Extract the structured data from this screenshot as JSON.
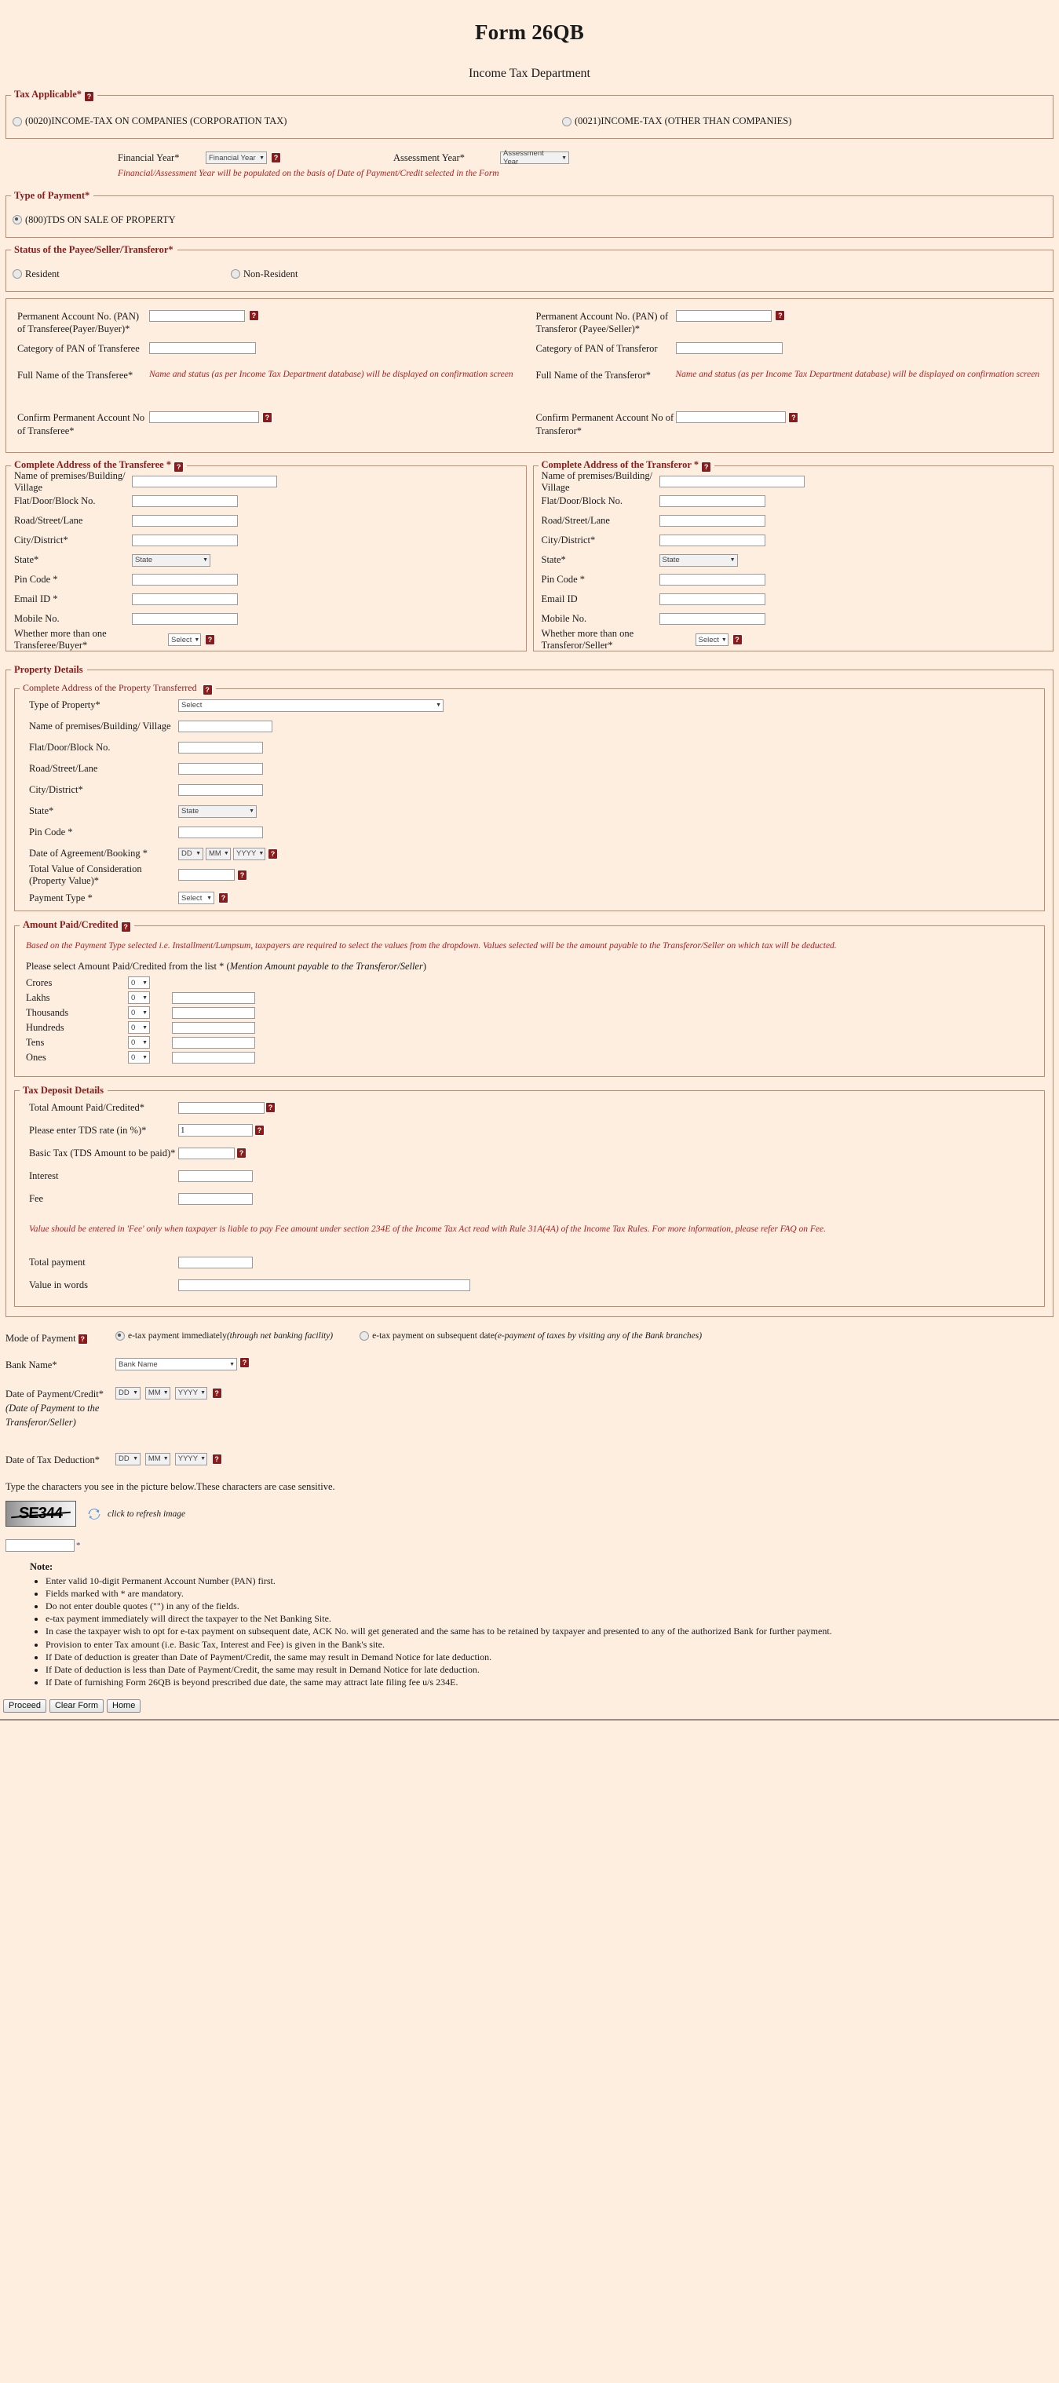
{
  "header": {
    "form_title": "Form 26QB",
    "dept_title": "Income Tax Department"
  },
  "tax_applicable": {
    "legend": "Tax Applicable*",
    "help_icon": "question-icon",
    "options": [
      {
        "label": "(0020)INCOME-TAX ON COMPANIES (CORPORATION TAX)",
        "selected": false
      },
      {
        "label": "(0021)INCOME-TAX (OTHER THAN COMPANIES)",
        "selected": false
      }
    ],
    "financial_year_label": "Financial Year*",
    "financial_year_value": "Financial Year",
    "assessment_year_label": "Assessment Year*",
    "assessment_year_value": "Assessment Year",
    "year_note": "Financial/Assessment Year will be populated on the basis of Date of Payment/Credit selected in the Form"
  },
  "type_of_payment": {
    "legend": "Type of Payment*",
    "options": [
      {
        "label": "(800)TDS ON SALE OF PROPERTY",
        "selected": true
      }
    ]
  },
  "status_of_payee": {
    "legend": "Status of the Payee/Seller/Transferor*",
    "options": [
      {
        "label": "Resident",
        "selected": false
      },
      {
        "label": "Non-Resident",
        "selected": false
      }
    ]
  },
  "pan_section": {
    "transferee": {
      "pan_label": "Permanent Account No. (PAN) of Transferee(Payer/Buyer)*",
      "pan_value": "",
      "category_label": "Category of PAN of Transferee",
      "category_value": "",
      "full_name_label": "Full Name of the Transferee*",
      "full_name_hint": "Name and status (as per Income Tax Department database) will be displayed on confirmation screen",
      "confirm_label": "Confirm Permanent Account No of Transferee*",
      "confirm_value": ""
    },
    "transferor": {
      "pan_label": "Permanent Account No. (PAN) of Transferor (Payee/Seller)*",
      "pan_value": "",
      "category_label": "Category of PAN of Transferor",
      "category_value": "",
      "full_name_label": "Full Name of the Transferor*",
      "full_name_hint": "Name and status (as per Income Tax Department database) will be displayed on confirmation screen",
      "confirm_label": "Confirm Permanent Account No of Transferor*",
      "confirm_value": ""
    }
  },
  "address_transferee": {
    "legend": "Complete Address of the Transferee *",
    "fields": [
      {
        "label": "Name of premises/Building/ Village",
        "type": "text",
        "value": "",
        "width": "xl"
      },
      {
        "label": "Flat/Door/Block No.",
        "type": "text",
        "value": "",
        "width": "lg"
      },
      {
        "label": "Road/Street/Lane",
        "type": "text",
        "value": "",
        "width": "lg"
      },
      {
        "label": "City/District*",
        "type": "text",
        "value": "",
        "width": "lg"
      },
      {
        "label": "State*",
        "type": "select",
        "value": "State",
        "width": "state"
      },
      {
        "label": "Pin Code *",
        "type": "text",
        "value": "",
        "width": "lg"
      },
      {
        "label": "Email ID *",
        "type": "text",
        "value": "",
        "width": "lg"
      },
      {
        "label": "Mobile No.",
        "type": "text",
        "value": "",
        "width": "lg"
      }
    ],
    "multi_label": "Whether more than one Transferee/Buyer*",
    "multi_value": "Select"
  },
  "address_transferor": {
    "legend": "Complete Address of the Transferor *",
    "fields": [
      {
        "label": "Name of premises/Building/ Village",
        "type": "text",
        "value": "",
        "width": "xl"
      },
      {
        "label": "Flat/Door/Block No.",
        "type": "text",
        "value": "",
        "width": "lg"
      },
      {
        "label": "Road/Street/Lane",
        "type": "text",
        "value": "",
        "width": "lg"
      },
      {
        "label": "City/District*",
        "type": "text",
        "value": "",
        "width": "lg"
      },
      {
        "label": "State*",
        "type": "select",
        "value": "State",
        "width": "state"
      },
      {
        "label": "Pin Code *",
        "type": "text",
        "value": "",
        "width": "lg"
      },
      {
        "label": "Email ID",
        "type": "text",
        "value": "",
        "width": "lg"
      },
      {
        "label": "Mobile No.",
        "type": "text",
        "value": "",
        "width": "lg"
      }
    ],
    "multi_label": "Whether more than one Transferor/Seller*",
    "multi_value": "Select"
  },
  "property_details": {
    "legend": "Property Details",
    "address_legend": "Complete Address of the Property Transferred",
    "type_of_property_label": "Type of Property*",
    "type_of_property_value": "Select",
    "fields": [
      {
        "label": "Name of premises/Building/ Village",
        "type": "text",
        "value": "",
        "width": "xl"
      },
      {
        "label": "Flat/Door/Block No.",
        "type": "text",
        "value": "",
        "width": "lg"
      },
      {
        "label": "Road/Street/Lane",
        "type": "text",
        "value": "",
        "width": "lg"
      },
      {
        "label": "City/District*",
        "type": "text",
        "value": "",
        "width": "lg"
      },
      {
        "label": "State*",
        "type": "select",
        "value": "State",
        "width": "state"
      },
      {
        "label": "Pin Code *",
        "type": "text",
        "value": "",
        "width": "lg"
      }
    ],
    "date_agreement_label": "Date of Agreement/Booking *",
    "date_agreement": {
      "dd": "DD",
      "mm": "MM",
      "yyyy": "YYYY"
    },
    "total_value_label": "Total Value of Consideration (Property Value)*",
    "total_value": "",
    "payment_type_label": "Payment Type *",
    "payment_type_value": "Select"
  },
  "amount_paid": {
    "legend": "Amount Paid/Credited",
    "note": "Based on the Payment Type selected i.e. Installment/Lumpsum, taxpayers are required to select the values from the dropdown. Values selected will be the amount payable to the Transferor/Seller on which tax will be deducted.",
    "instruction_plain": "Please select Amount Paid/Credited from the list * (",
    "instruction_italic": "Mention Amount payable to the Transferor/Seller",
    "instruction_tail": ")",
    "rows": [
      {
        "label": "Crores",
        "select": "0",
        "text": "",
        "has_text": false
      },
      {
        "label": "Lakhs",
        "select": "0",
        "text": "",
        "has_text": true
      },
      {
        "label": "Thousands",
        "select": "0",
        "text": "",
        "has_text": true
      },
      {
        "label": "Hundreds",
        "select": "0",
        "text": "",
        "has_text": true
      },
      {
        "label": "Tens",
        "select": "0",
        "text": "",
        "has_text": true
      },
      {
        "label": "Ones",
        "select": "0",
        "text": "",
        "has_text": true
      }
    ]
  },
  "tax_deposit": {
    "legend": "Tax Deposit Details",
    "rows": [
      {
        "label": "Total Amount Paid/Credited*",
        "value": "",
        "width": "xl",
        "help": true
      },
      {
        "label": "Please enter TDS rate (in %)*",
        "value": "1",
        "width": "lg",
        "help": true
      },
      {
        "label": "Basic Tax (TDS Amount to be paid)*",
        "value": "",
        "width": "sm",
        "help": true
      },
      {
        "label": "Interest",
        "value": "",
        "width": "lg",
        "help": false
      },
      {
        "label": "Fee",
        "value": "",
        "width": "lg",
        "help": false
      }
    ],
    "fee_note": "Value should be entered in 'Fee' only when taxpayer is liable to pay Fee amount under section 234E of the Income Tax Act read with Rule 31A(4A) of the Income Tax Rules. For more information, please refer FAQ on Fee.",
    "total_payment_label": "Total payment",
    "total_payment_value": "",
    "value_words_label": "Value in words",
    "value_words_value": ""
  },
  "mode_of_payment": {
    "label": "Mode of Payment",
    "options": [
      {
        "plain": "e-tax payment immediately ",
        "italic": "(through net banking facility)",
        "selected": true
      },
      {
        "plain": "e-tax payment on subsequent date ",
        "italic": "(e-payment of taxes by visiting any of the Bank branches)",
        "selected": false
      }
    ],
    "bank_name_label": "Bank Name*",
    "bank_name_value": "Bank Name",
    "date_payment_label": "Date of Payment/Credit*",
    "date_payment_sub": "(Date of Payment to the Transferor/Seller)",
    "date_payment": {
      "dd": "DD",
      "mm": "MM",
      "yyyy": "YYYY"
    },
    "date_deduction_label": "Date of Tax Deduction*",
    "date_deduction": {
      "dd": "DD",
      "mm": "MM",
      "yyyy": "YYYY"
    }
  },
  "captcha": {
    "instruction": "Type the characters you see in the picture below.These characters are case sensitive.",
    "image_text": "SE344",
    "refresh_label": "click to refresh image",
    "input_value": "",
    "required_mark": "*"
  },
  "notes": {
    "title": "Note:",
    "items": [
      "Enter valid 10-digit Permanent Account Number (PAN) first.",
      "Fields marked with * are mandatory.",
      "Do not enter double quotes (\"\") in any of the fields.",
      "e-tax payment immediately will direct the taxpayer to the Net Banking Site.",
      "In case the taxpayer wish to opt for e-tax payment on subsequent date, ACK No. will get generated and the same has to be retained by taxpayer and presented to any of the authorized Bank for further payment.",
      "Provision to enter Tax amount (i.e. Basic Tax, Interest and Fee) is given in the Bank's site.",
      "If Date of deduction is greater than Date of Payment/Credit, the same may result in Demand Notice for late deduction.",
      "If Date of deduction is less than Date of Payment/Credit, the same may result in Demand Notice for late deduction.",
      "If Date of furnishing Form 26QB is beyond prescribed due date, the same may attract late filing fee u/s 234E."
    ]
  },
  "footer_buttons": [
    {
      "label": "Proceed"
    },
    {
      "label": "Clear Form"
    },
    {
      "label": "Home"
    }
  ],
  "colors": {
    "page_bg": "#fdeee0",
    "legend_red": "#8b1a1a",
    "hint_red": "#b02020",
    "border": "#c48a6e"
  },
  "help_icon_glyph": "?"
}
